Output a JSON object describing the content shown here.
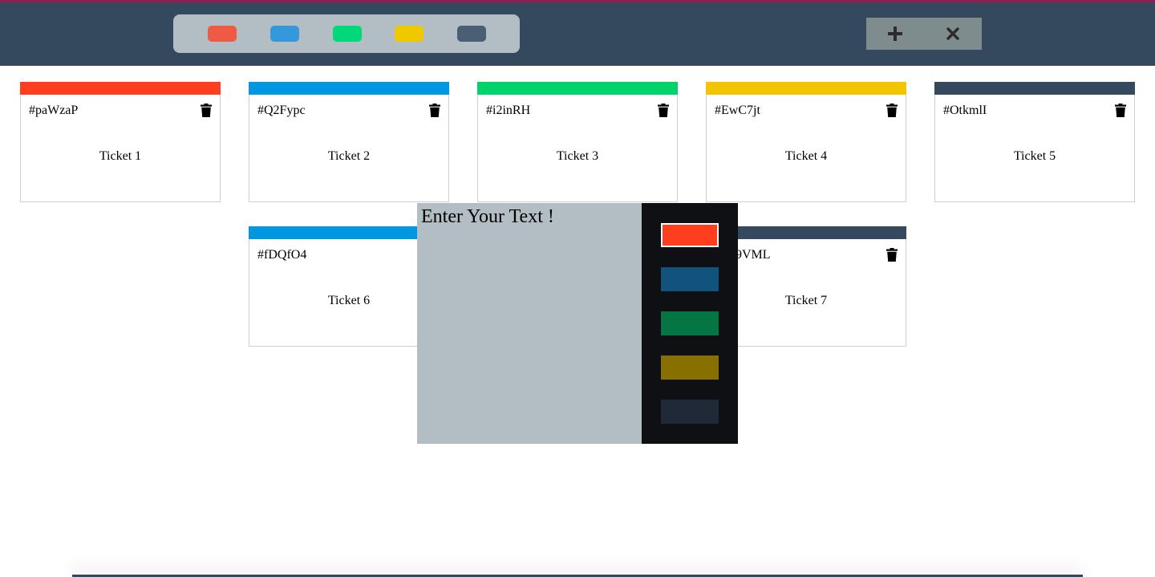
{
  "colors": {
    "topbar": "#34495e",
    "filter_bg": "#b2bec3",
    "red": "#ff3d1f",
    "blue": "#0096e0",
    "green": "#00d36a",
    "yellow": "#f3c500",
    "dark": "#34495e"
  },
  "toolbar": {
    "filters": [
      {
        "name": "red",
        "color": "#ef5a44"
      },
      {
        "name": "blue",
        "color": "#3498db"
      },
      {
        "name": "green",
        "color": "#00d97a"
      },
      {
        "name": "yellow",
        "color": "#eec900"
      },
      {
        "name": "dark",
        "color": "#4a5f75"
      }
    ],
    "add_icon": "plus-icon",
    "remove_icon": "close-icon"
  },
  "tickets": [
    {
      "id": "#paWzaP",
      "task": "Ticket 1",
      "color": "#ff3d1f"
    },
    {
      "id": "#Q2Fypc",
      "task": "Ticket 2",
      "color": "#0096e0"
    },
    {
      "id": "#i2inRH",
      "task": "Ticket 3",
      "color": "#00d36a"
    },
    {
      "id": "#EwC7jt",
      "task": "Ticket 4",
      "color": "#f3c500"
    },
    {
      "id": "#OtkmlI",
      "task": "Ticket 5",
      "color": "#34495e"
    },
    {
      "id": "#fDQfO4",
      "task": "Ticket 6",
      "color": "#0096e0"
    },
    {
      "id": "9VML",
      "task": "Ticket 7",
      "color": "#34495e"
    }
  ],
  "modal": {
    "placeholder": "Enter Your Text !",
    "priority_colors": [
      {
        "name": "red",
        "color": "#ff3d1f",
        "active": true
      },
      {
        "name": "blue",
        "color": "#12537e",
        "active": false
      },
      {
        "name": "green",
        "color": "#047543",
        "active": false
      },
      {
        "name": "yellow",
        "color": "#877000",
        "active": false
      },
      {
        "name": "dark",
        "color": "#1f2937",
        "active": false
      }
    ]
  }
}
